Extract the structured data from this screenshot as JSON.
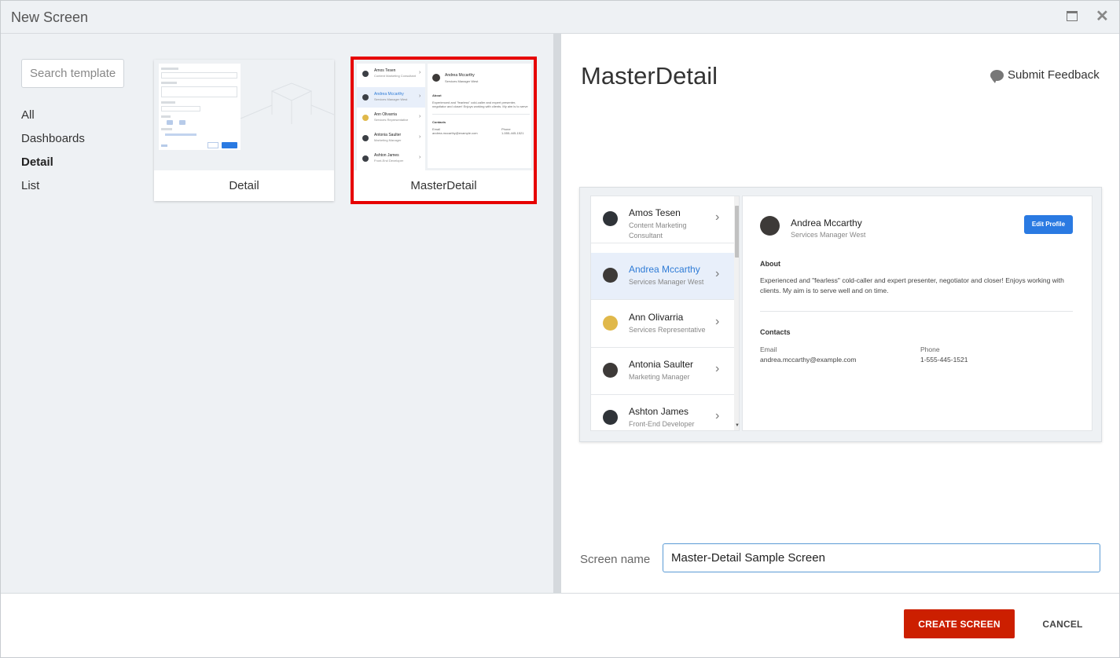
{
  "window": {
    "title": "New Screen"
  },
  "search": {
    "placeholder": "Search templates"
  },
  "categories": [
    {
      "label": "All",
      "active": false
    },
    {
      "label": "Dashboards",
      "active": false
    },
    {
      "label": "Detail",
      "active": true
    },
    {
      "label": "List",
      "active": false
    }
  ],
  "templates": [
    {
      "label": "Detail",
      "selected": false
    },
    {
      "label": "MasterDetail",
      "selected": true
    }
  ],
  "preview": {
    "title": "MasterDetail",
    "feedback_label": "Submit Feedback",
    "list": [
      {
        "name": "Amos Tesen",
        "role": "Content Marketing Consultant"
      },
      {
        "name": "Andrea Mccarthy",
        "role": "Services Manager West",
        "selected": true
      },
      {
        "name": "Ann Olivarria",
        "role": "Services Representative"
      },
      {
        "name": "Antonia Saulter",
        "role": "Marketing Manager"
      },
      {
        "name": "Ashton James",
        "role": "Front-End Developer"
      }
    ],
    "detail": {
      "name": "Andrea Mccarthy",
      "role": "Services Manager West",
      "edit_label": "Edit Profile",
      "about_heading": "About",
      "about_text": "Experienced and \"fearless\" cold-caller and expert presenter, negotiator and closer! Enjoys working with clients. My aim is to serve well and on time.",
      "contacts_heading": "Contacts",
      "email_label": "Email",
      "email_value": "andrea.mccarthy@example.com",
      "phone_label": "Phone",
      "phone_value": "1-555-445-1521"
    }
  },
  "screen_name": {
    "label": "Screen name",
    "value": "Master-Detail Sample Screen"
  },
  "footer": {
    "create_label": "CREATE SCREEN",
    "cancel_label": "CANCEL"
  },
  "colors": {
    "primary_action": "#cc1f00",
    "selection_outline": "#e60000",
    "link_blue": "#2e7bd6",
    "edit_button": "#2a7ae2"
  }
}
